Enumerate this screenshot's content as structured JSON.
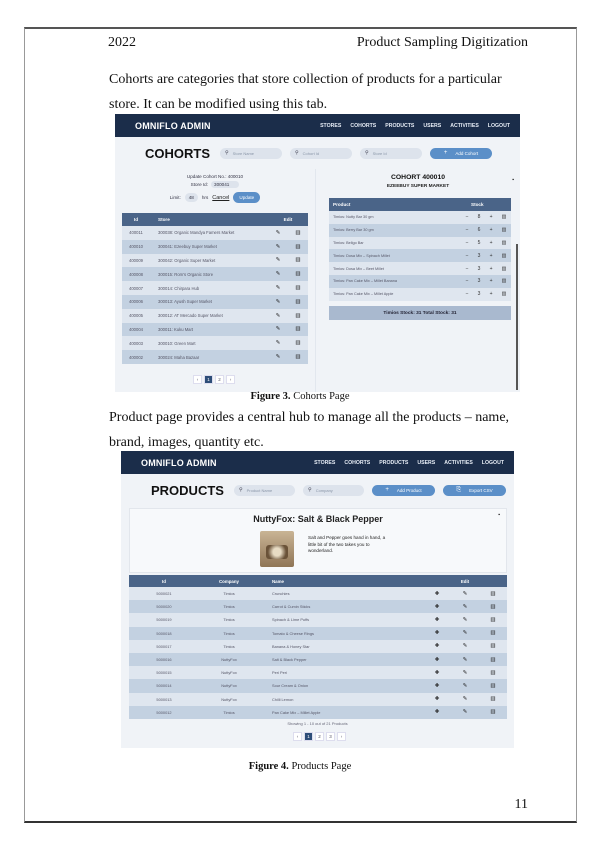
{
  "document": {
    "header_left": "2022",
    "header_right": "Product Sampling Digitization",
    "paragraph_1": "Cohorts are categories that store collection of products for a particular store. It can be modified using this tab.",
    "figure_3_label": "Figure 3.",
    "figure_3_caption": "Cohorts Page",
    "paragraph_2": "Product page provides a central hub to manage all the products – name, brand, images, quantity etc.",
    "figure_4_label": "Figure 4.",
    "figure_4_caption": "Products Page",
    "page_number": "11"
  },
  "nav": {
    "brand": "OMNIFLO ADMIN",
    "links": [
      "STORES",
      "COHORTS",
      "PRODUCTS",
      "USERS",
      "ACTIVITIES",
      "LOGOUT"
    ]
  },
  "cohorts_page": {
    "title": "COHORTS",
    "search_store_name": "Store Name",
    "search_cohort_id": "Cohort Id",
    "search_store_id": "Store Id",
    "add_button": "Add Cohort",
    "update_form": {
      "heading": "Update Cohort No.: 400010",
      "store_id_label": "Store Id:",
      "store_id_value": "300041",
      "limit_label": "Limit:",
      "limit_value": "48",
      "limit_unit": "hrs",
      "cancel_label": "Cancel",
      "update_label": "Update"
    },
    "table_headers": {
      "id": "Id",
      "store": "Store",
      "edit": "Edit"
    },
    "rows": [
      {
        "id": "400011",
        "store": "300038: Organic Mandya Famers Market"
      },
      {
        "id": "400010",
        "store": "300041: Ezeebuy Super Market"
      },
      {
        "id": "400009",
        "store": "300042: Organic Super Market"
      },
      {
        "id": "400008",
        "store": "300015: Rom's Organic Store"
      },
      {
        "id": "400007",
        "store": "300014: Chirpara Hub"
      },
      {
        "id": "400006",
        "store": "300013: Ayush Super Market"
      },
      {
        "id": "400005",
        "store": "300012: AT Mercado Super Market"
      },
      {
        "id": "400004",
        "store": "300011: Kuku Mart"
      },
      {
        "id": "400003",
        "store": "300010: Green Mart"
      },
      {
        "id": "400002",
        "store": "300024: Maha Bazaar"
      }
    ],
    "pagination": [
      "‹",
      "1",
      "2",
      "›"
    ],
    "active_page": "1",
    "detail": {
      "title": "COHORT 400010",
      "subtitle": "EZEEBUY SUPER MARKET",
      "product_header": "Product",
      "stock_header": "Stock",
      "products": [
        {
          "name": "Timios: Nutty Bar 30 gm",
          "stock": "8"
        },
        {
          "name": "Timios: Berry Bar 30 gm",
          "stock": "6"
        },
        {
          "name": "Timios: Bellgo Bar",
          "stock": "5"
        },
        {
          "name": "Timios: Dosa Mix – Spinach Millet",
          "stock": "3"
        },
        {
          "name": "Timios: Dosa Mix – Beet Millet",
          "stock": "3"
        },
        {
          "name": "Timios: Pan Cake Mix – Millet Banana",
          "stock": "3"
        },
        {
          "name": "Timios: Pan Cake Mix – Millet Apple",
          "stock": "3"
        }
      ],
      "totals": "Timios Stock: 31   Total Stock: 31"
    }
  },
  "products_page": {
    "title": "PRODUCTS",
    "search_product_name": "Product Name",
    "search_company": "Company",
    "add_button": "Add Product",
    "export_button": "Export CSV",
    "modal": {
      "title": "NuttyFox: Salt & Black Pepper",
      "description": "Salt and Pepper goes hand in hand, a little bit of the two takes you to wonderland."
    },
    "table_headers": {
      "id": "Id",
      "company": "Company",
      "name": "Name",
      "edit": "Edit"
    },
    "rows": [
      {
        "id": "5000021",
        "company": "Timios",
        "name": "Crunchies"
      },
      {
        "id": "5000020",
        "company": "Timios",
        "name": "Carrot & Cumin Sticks"
      },
      {
        "id": "5000019",
        "company": "Timios",
        "name": "Spinach & Lime Puffs"
      },
      {
        "id": "5000018",
        "company": "Timios",
        "name": "Tomato & Cheese Rings"
      },
      {
        "id": "5000017",
        "company": "Timios",
        "name": "Banana & Honey Star"
      },
      {
        "id": "5000016",
        "company": "NuttyFox",
        "name": "Salt & Black Pepper"
      },
      {
        "id": "5000015",
        "company": "NuttyFox",
        "name": "Peri Peri"
      },
      {
        "id": "5000014",
        "company": "NuttyFox",
        "name": "Sour Cream & Onion"
      },
      {
        "id": "5000013",
        "company": "NuttyFox",
        "name": "Chilli Lemon"
      },
      {
        "id": "5000012",
        "company": "Timios",
        "name": "Pan Cake Mix – Millet Apple"
      }
    ],
    "showing": "Showing 1 - 10 out of 21 Products",
    "pagination": [
      "‹",
      "1",
      "2",
      "3",
      "›"
    ],
    "active_page": "1"
  },
  "icons": {
    "search": "🔍",
    "plus": "+",
    "edit": "✎",
    "delete": "🗑",
    "minus": "−",
    "close": "×",
    "export": "⎘"
  }
}
